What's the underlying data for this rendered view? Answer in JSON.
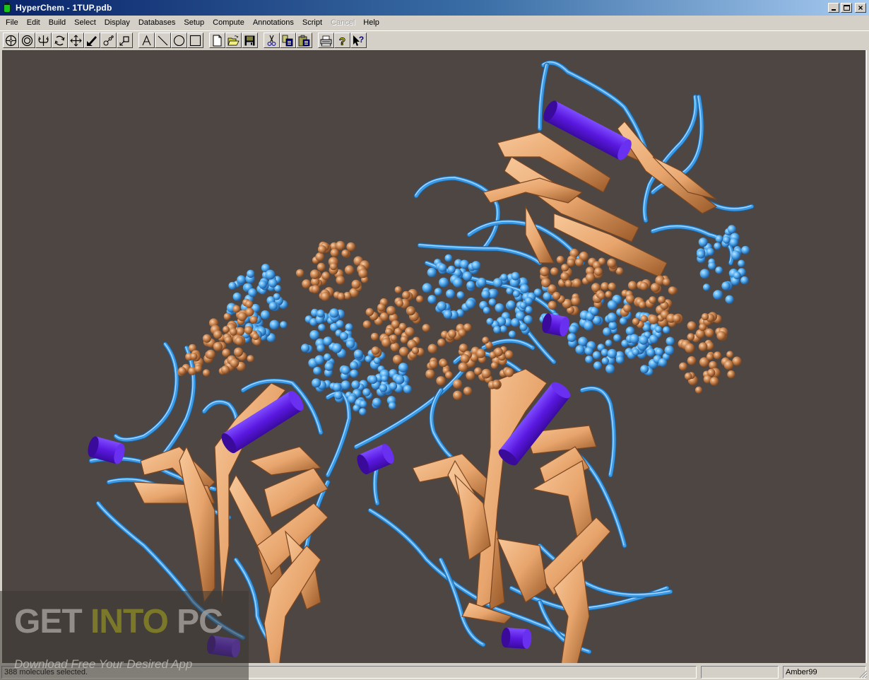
{
  "window": {
    "title": "HyperChem - 1TUP.pdb",
    "controls": {
      "minimize": "_",
      "maximize": "□",
      "close": "×"
    }
  },
  "menu": {
    "items": [
      {
        "label": "File"
      },
      {
        "label": "Edit"
      },
      {
        "label": "Build"
      },
      {
        "label": "Select"
      },
      {
        "label": "Display"
      },
      {
        "label": "Databases"
      },
      {
        "label": "Setup"
      },
      {
        "label": "Compute"
      },
      {
        "label": "Annotations"
      },
      {
        "label": "Script"
      },
      {
        "label": "Cancel",
        "disabled": true
      },
      {
        "label": "Help"
      }
    ]
  },
  "toolbar": {
    "groups": [
      [
        "select-tool-icon",
        "select-sphere-icon",
        "rotate-out-of-plane-icon",
        "rotate-in-plane-icon",
        "translate-icon",
        "z-translate-icon",
        "zoom-icon",
        "clip-icon"
      ],
      [
        "text-annotation-icon",
        "line-annotation-icon",
        "ellipse-annotation-icon",
        "rectangle-annotation-icon"
      ],
      [
        "new-file-icon",
        "open-file-icon",
        "save-file-icon"
      ],
      [
        "cut-icon",
        "copy-icon",
        "paste-icon"
      ],
      [
        "print-icon",
        "help-icon",
        "context-help-icon"
      ]
    ]
  },
  "viewer": {
    "background": "#4e4642",
    "molecule": "1TUP",
    "colors": {
      "coil": "#3b9be6",
      "sheet": "#e8a56d",
      "helix": "#5a18e0",
      "dna_strand_a": "#5ab4f5",
      "dna_strand_b": "#cf8a55"
    }
  },
  "status": {
    "message": "388 molecules selected.",
    "panel2": "",
    "panel3": "",
    "forcefield": "Amber99"
  },
  "watermark": {
    "word1": "GET",
    "word2": "INTO",
    "word3": "PC",
    "tagline": "Download Free Your Desired App"
  }
}
